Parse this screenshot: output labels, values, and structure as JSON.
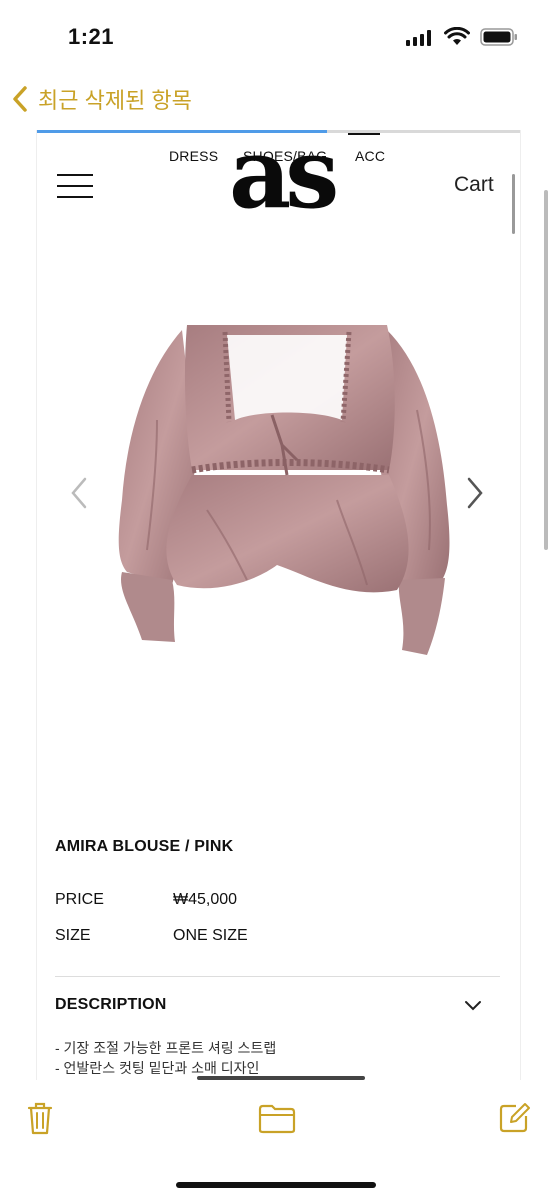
{
  "status_bar": {
    "time": "1:21"
  },
  "nav": {
    "back_label": "최근 삭제된 항목"
  },
  "page_progress": 0.6,
  "site": {
    "categories": [
      "DRESS",
      "SHOES/BAG",
      "ACC"
    ],
    "logo": "as",
    "cart_label": "Cart"
  },
  "product": {
    "name": "AMIRA BLOUSE / PINK",
    "price_label": "PRICE",
    "price_value": "₩45,000",
    "size_label": "SIZE",
    "size_value": "ONE SIZE",
    "description_title": "DESCRIPTION",
    "description_lines": [
      "- 기장 조절 가능한 프론트 셔링 스트랩",
      "- 언발란스 컷팅 밑단과 소매 디자인"
    ]
  },
  "colors": {
    "accent": "#c9a227",
    "product_pink": "#b88d8e"
  },
  "icons": [
    "signal-icon",
    "wifi-icon",
    "battery-icon",
    "chevron-left-icon",
    "hamburger-icon",
    "arrow-left-icon",
    "arrow-right-icon",
    "chevron-down-icon",
    "trash-icon",
    "folder-icon",
    "compose-icon"
  ]
}
